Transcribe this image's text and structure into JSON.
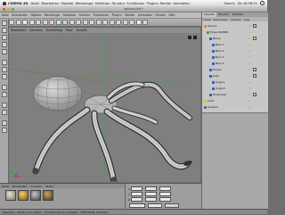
{
  "menubar": {
    "app_name": "CINEMA 4D",
    "items": [
      "Datei",
      "Bearbeiten",
      "Objekte",
      "Werkzeuge",
      "Selektion",
      "Struktur",
      "Funktionen",
      "Plugins",
      "Render",
      "Animation",
      "Fenster",
      "Hilfe"
    ],
    "clock": "Do 18:58:51",
    "search": "Search"
  },
  "window": {
    "title": "spinne.c4d *"
  },
  "app_menu": {
    "items": [
      "Datei",
      "Bearbeiten",
      "Objekte",
      "Werkzeuge",
      "Selektion",
      "Struktur",
      "Funktionen",
      "Plugins",
      "Render",
      "Animation",
      "Fenster",
      "Hilfe"
    ]
  },
  "viewport": {
    "menu": [
      "Bearbeiten",
      "Kameras",
      "Darstellung",
      "Filter",
      "Ansicht"
    ],
    "label": "Zentralperspektive"
  },
  "object_manager": {
    "tabs": [
      "Objekte",
      "Struktur",
      "Browser"
    ],
    "menu": [
      "Datei",
      "Bearbeiten",
      "Objekte",
      "Tags",
      "Textur"
    ],
    "rows": [
      {
        "label": "Spinne",
        "indent": 0
      },
      {
        "label": "Hyper-NURBS",
        "indent": 1
      },
      {
        "label": "Beine",
        "indent": 2
      },
      {
        "label": "Bein 1",
        "indent": 3
      },
      {
        "label": "Bein 2",
        "indent": 3
      },
      {
        "label": "Bein 3",
        "indent": 3
      },
      {
        "label": "Bein 4",
        "indent": 3
      },
      {
        "label": "Körper",
        "indent": 2
      },
      {
        "label": "Kopf",
        "indent": 2
      },
      {
        "label": "Auge.1",
        "indent": 3
      },
      {
        "label": "Auge.2",
        "indent": 3
      },
      {
        "label": "Hinterleib",
        "indent": 2
      },
      {
        "label": "Licht",
        "indent": 0
      },
      {
        "label": "Kamera",
        "indent": 0
      },
      {
        "label": "Boden",
        "indent": 0
      }
    ]
  },
  "material_manager": {
    "menu": [
      "Datei",
      "Bearbeiten",
      "Funktion",
      "Textur"
    ]
  },
  "coordinates": {
    "rows": [
      {
        "axis": "X",
        "pos": "0 m",
        "size": "0 m",
        "rot": "0 °"
      },
      {
        "axis": "Y",
        "pos": "0 m",
        "size": "0 m",
        "rot": "0 °"
      },
      {
        "axis": "Z",
        "pos": "0 m",
        "size": "0 m",
        "rot": "0 °"
      }
    ],
    "mode": "Objekt",
    "apply": "Anwenden"
  },
  "status": {
    "text": "Bewegen: Klicken und ziehen, um Elemente zu bewegen. SHIFT-Taste benutzen"
  },
  "colors": {
    "viewport_bg": "#7f7f7f",
    "x_axis": "#d12a2a",
    "y_axis": "#2bb52b",
    "z_axis": "#2a4ed1"
  }
}
